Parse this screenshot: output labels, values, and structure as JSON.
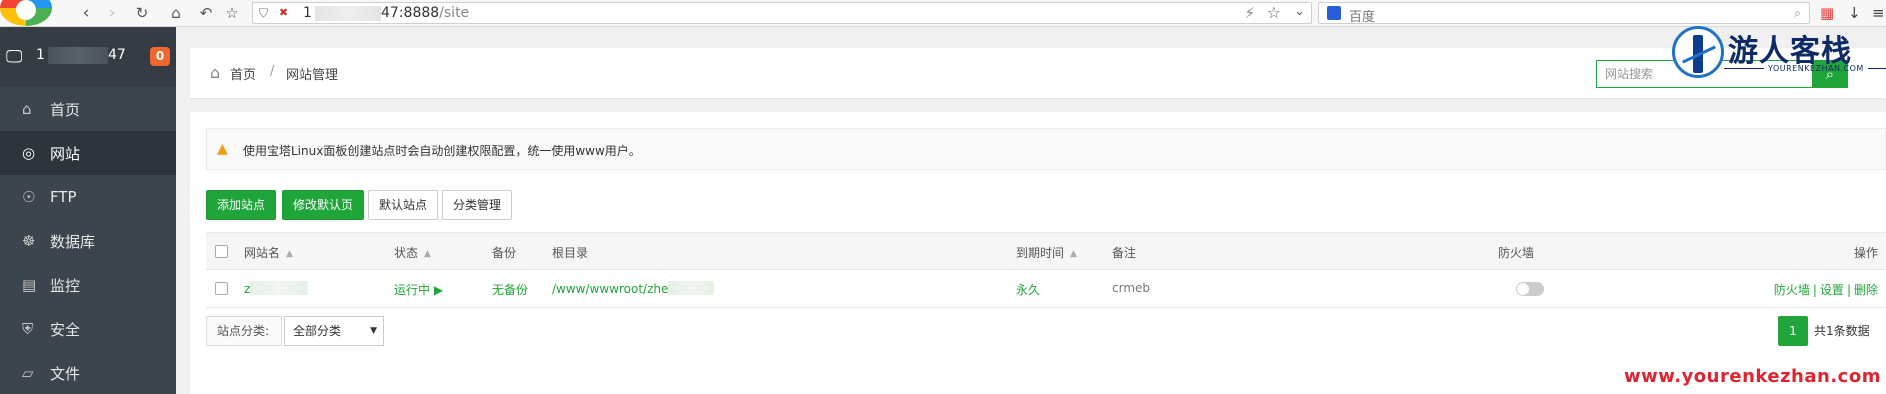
{
  "browser": {
    "url_prefix": "1",
    "url_suffix": "47:8888",
    "url_path": "/site",
    "search_placeholder": "百度"
  },
  "sidebar": {
    "server_ip_prefix": "1",
    "server_ip_suffix": "47",
    "notification_count": "0",
    "items": [
      {
        "label": "首页",
        "icon": "home-icon",
        "active": false
      },
      {
        "label": "网站",
        "icon": "globe-icon",
        "active": true
      },
      {
        "label": "FTP",
        "icon": "ftp-icon",
        "active": false
      },
      {
        "label": "数据库",
        "icon": "database-icon",
        "active": false
      },
      {
        "label": "监控",
        "icon": "monitor-chart-icon",
        "active": false
      },
      {
        "label": "安全",
        "icon": "shield-icon",
        "active": false
      },
      {
        "label": "文件",
        "icon": "folder-icon",
        "active": false
      }
    ]
  },
  "breadcrumb": {
    "home": "首页",
    "separator": "/",
    "current": "网站管理"
  },
  "site_search": {
    "placeholder": "网站搜索"
  },
  "watermark": {
    "title": "游人客栈",
    "subtitle": "YOURENKEZHAN.COM",
    "url": "www.yourenkezhan.com"
  },
  "alert": {
    "text": "使用宝塔Linux面板创建站点时会自动创建权限配置，统一使用www用户。"
  },
  "toolbar": {
    "add_site": "添加站点",
    "edit_default_page": "修改默认页",
    "default_site": "默认站点",
    "category_manage": "分类管理"
  },
  "table": {
    "headers": {
      "name": "网站名",
      "status": "状态",
      "backup": "备份",
      "root": "根目录",
      "expire": "到期时间",
      "remark": "备注",
      "firewall": "防火墙",
      "ops": "操作"
    },
    "rows": [
      {
        "name_prefix": "z",
        "status": "运行中",
        "backup": "无备份",
        "root_prefix": "/www/wwwroot/zhe",
        "expire": "永久",
        "remark": "crmeb",
        "firewall_enabled": false,
        "op_firewall": "防火墙",
        "op_settings": "设置",
        "op_delete": "删除"
      }
    ]
  },
  "filter": {
    "label": "站点分类:",
    "selected": "全部分类"
  },
  "pagination": {
    "current_page": "1",
    "total_text": "共1条数据"
  },
  "colors": {
    "accent": "#20a53a",
    "sidebar_bg": "#3c444d",
    "badge": "#f0682d"
  }
}
